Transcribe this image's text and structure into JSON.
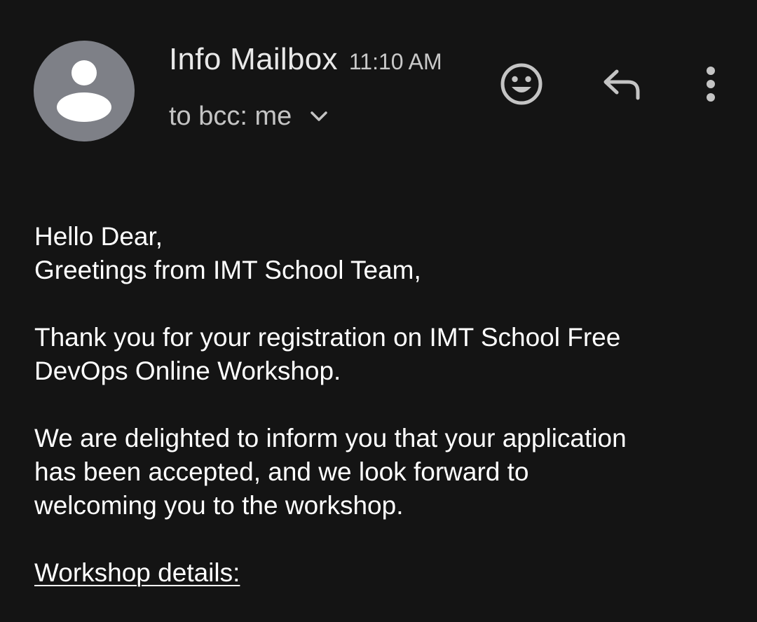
{
  "email": {
    "sender_name": "Info Mailbox",
    "time": "11:10 AM",
    "recipients": "to bcc: me"
  },
  "icons": {
    "avatar": "person-icon",
    "expand": "chevron-down-icon",
    "emoji": "smiley-icon",
    "reply": "reply-arrow-icon",
    "more": "more-vert-icon"
  },
  "colors": {
    "background": "#141414",
    "avatar_bg": "#7e8087",
    "icon_gray": "#c4c4c4",
    "text": "#ffffff"
  },
  "body": {
    "greeting": "Hello Dear,",
    "greeting_line2": "Greetings from IMT School Team,",
    "para1_line1": "Thank you for your registration on IMT School Free",
    "para1_line2": "DevOps Online Workshop.",
    "para2_line1": "We are delighted to inform you that your application",
    "para2_line2": "has been accepted, and we look forward to",
    "para2_line3": "welcoming you to the workshop.",
    "details_heading": "Workshop details:"
  }
}
